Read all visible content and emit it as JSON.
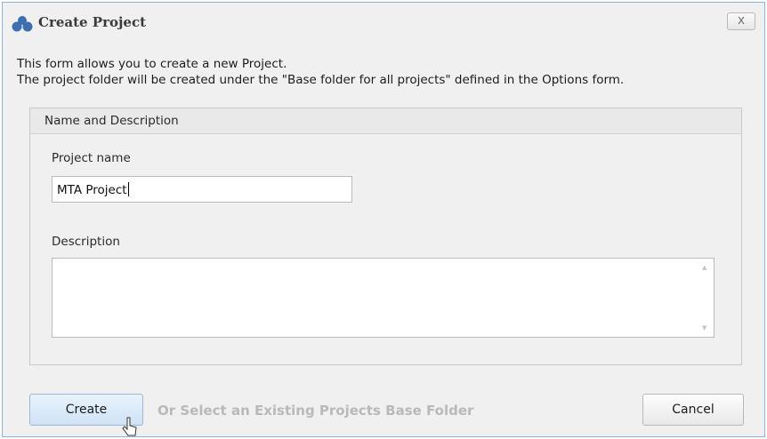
{
  "window": {
    "title": "Create Project",
    "close_glyph": "x",
    "icon": "app-logo-icon",
    "accent": "#3e6fb0"
  },
  "intro": {
    "line1": "This form allows you to create a new Project.",
    "line2": "The project folder will be created under the \"Base folder for all projects\" defined in the Options form."
  },
  "group": {
    "title": "Name and Description",
    "project_name_label": "Project name",
    "project_name_value": "MTA Project",
    "description_label": "Description",
    "description_value": ""
  },
  "footer": {
    "create_label": "Create",
    "select_folder_label": "Or Select an Existing Projects Base Folder",
    "cancel_label": "Cancel"
  }
}
